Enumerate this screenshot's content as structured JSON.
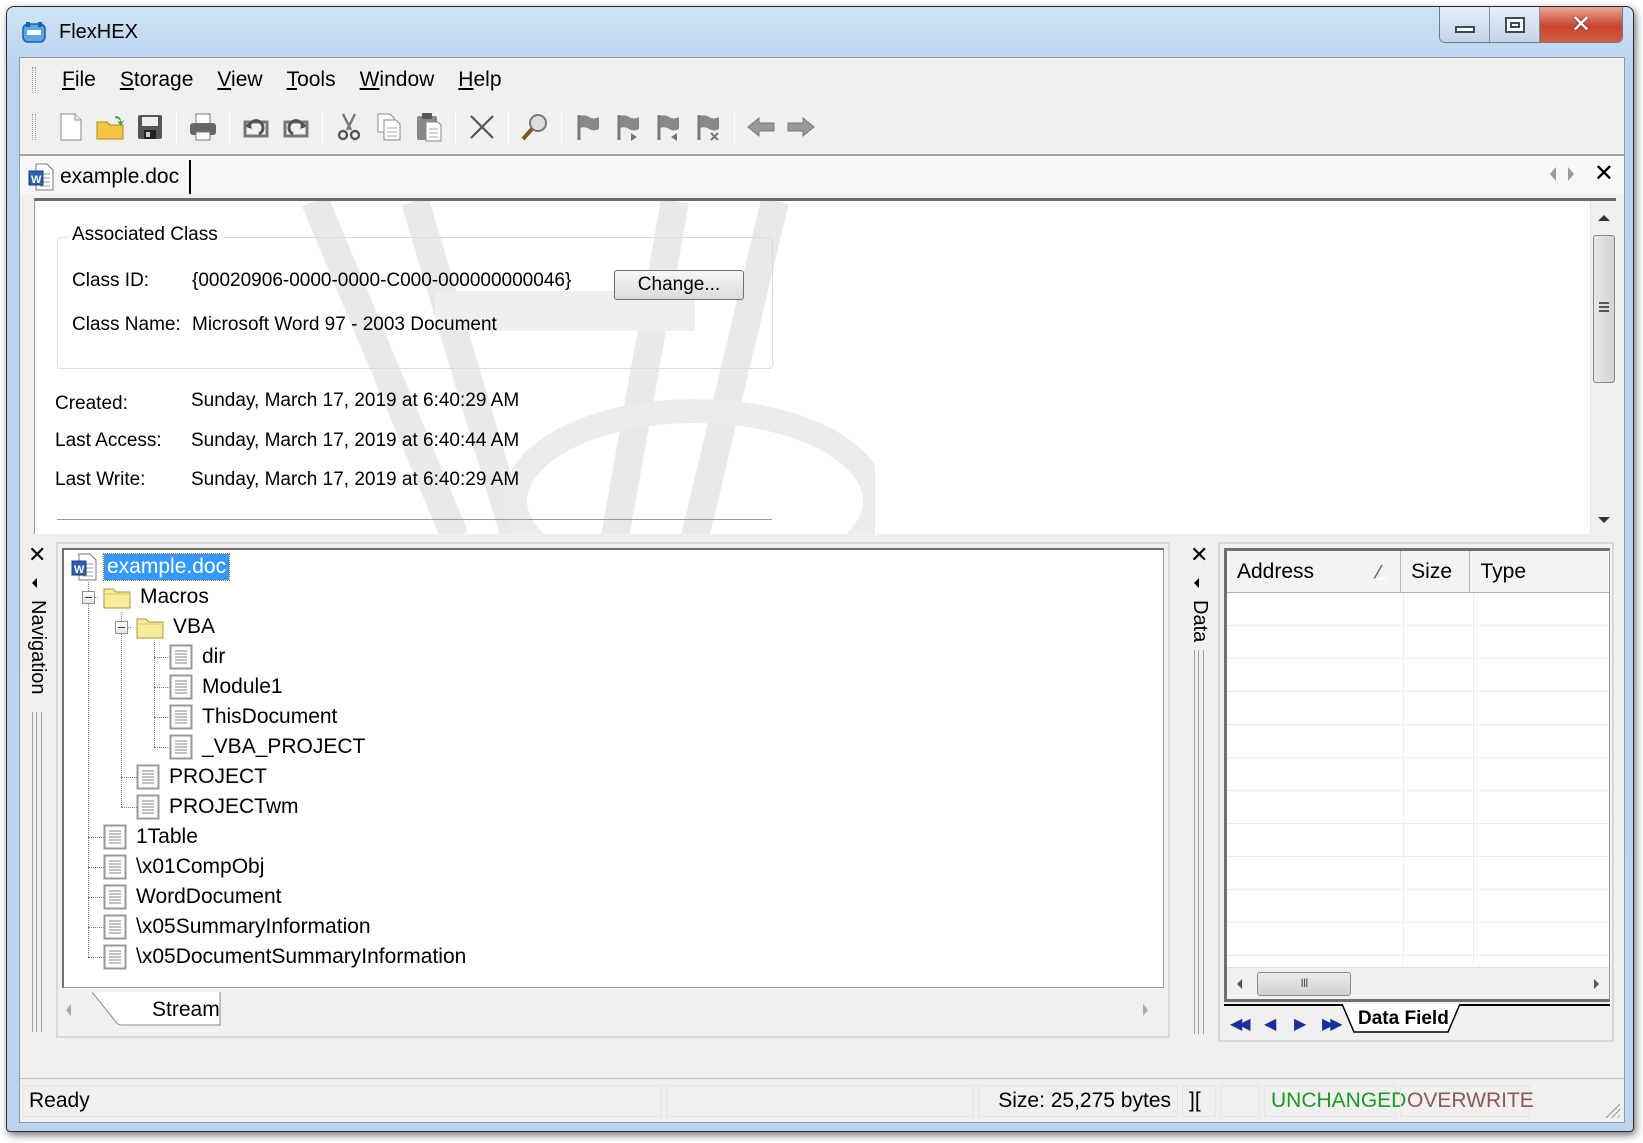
{
  "window": {
    "title": "FlexHEX",
    "controls": {
      "minimize": "minimize",
      "maximize": "maximize",
      "close": "close"
    }
  },
  "menu": [
    {
      "label": "File",
      "accel": "F",
      "rest": "ile"
    },
    {
      "label": "Storage",
      "accel": "S",
      "rest": "torage"
    },
    {
      "label": "View",
      "accel": "V",
      "rest": "iew"
    },
    {
      "label": "Tools",
      "accel": "T",
      "rest": "ools"
    },
    {
      "label": "Window",
      "accel": "W",
      "rest": "indow"
    },
    {
      "label": "Help",
      "accel": "H",
      "rest": "elp"
    }
  ],
  "toolbar": [
    "new-file",
    "open-folder",
    "save",
    "|",
    "print",
    "|",
    "undo",
    "redo",
    "|",
    "cut",
    "copy",
    "paste",
    "|",
    "delete",
    "|",
    "find",
    "|",
    "bookmark",
    "bookmark-next",
    "bookmark-prev",
    "bookmark-clear",
    "|",
    "back",
    "forward"
  ],
  "document_tab": {
    "label": "example.doc",
    "icon": "word-doc-icon"
  },
  "properties": {
    "group_title": "Associated Class",
    "class_id_label": "Class ID:",
    "class_id_value": "{00020906-0000-0000-C000-000000000046}",
    "change_button": "Change...",
    "class_name_label": "Class Name:",
    "class_name_value": "Microsoft Word 97 - 2003 Document",
    "created_label": "Created:",
    "created_value": "Sunday, March 17, 2019 at 6:40:29 AM",
    "last_access_label": "Last Access:",
    "last_access_value": "Sunday, March 17, 2019 at 6:40:44 AM",
    "last_write_label": "Last Write:",
    "last_write_value": "Sunday, March 17, 2019 at 6:40:29 AM"
  },
  "navigation": {
    "panel_label": "Navigation",
    "tree": [
      {
        "label": "example.doc",
        "type": "word-doc",
        "depth": 0,
        "selected": true
      },
      {
        "label": "Macros",
        "type": "folder",
        "depth": 1,
        "expanded": true
      },
      {
        "label": "VBA",
        "type": "folder",
        "depth": 2,
        "expanded": true
      },
      {
        "label": "dir",
        "type": "stream",
        "depth": 3
      },
      {
        "label": "Module1",
        "type": "stream",
        "depth": 3
      },
      {
        "label": "ThisDocument",
        "type": "stream",
        "depth": 3
      },
      {
        "label": "_VBA_PROJECT",
        "type": "stream",
        "depth": 3
      },
      {
        "label": "PROJECT",
        "type": "stream",
        "depth": 2
      },
      {
        "label": "PROJECTwm",
        "type": "stream",
        "depth": 2
      },
      {
        "label": "1Table",
        "type": "stream",
        "depth": 1
      },
      {
        "label": "\\x01CompObj",
        "type": "stream",
        "depth": 1
      },
      {
        "label": "WordDocument",
        "type": "stream",
        "depth": 1
      },
      {
        "label": "\\x05SummaryInformation",
        "type": "stream",
        "depth": 1
      },
      {
        "label": "\\x05DocumentSummaryInformation",
        "type": "stream",
        "depth": 1
      }
    ],
    "bottom_tab": "Stream"
  },
  "data_panel": {
    "panel_label": "Data",
    "columns": [
      "Address",
      "Size",
      "Type"
    ],
    "rows": [],
    "bottom_tab": "Data Field"
  },
  "statusbar": {
    "ready": "Ready",
    "size": "Size: 25,275 bytes",
    "cursor_glyph": "][",
    "modified_state": "UNCHANGED",
    "edit_mode": "OVERWRITE",
    "colors": {
      "unchanged": "#1a9a24",
      "overwrite": "#8a5a52"
    }
  }
}
